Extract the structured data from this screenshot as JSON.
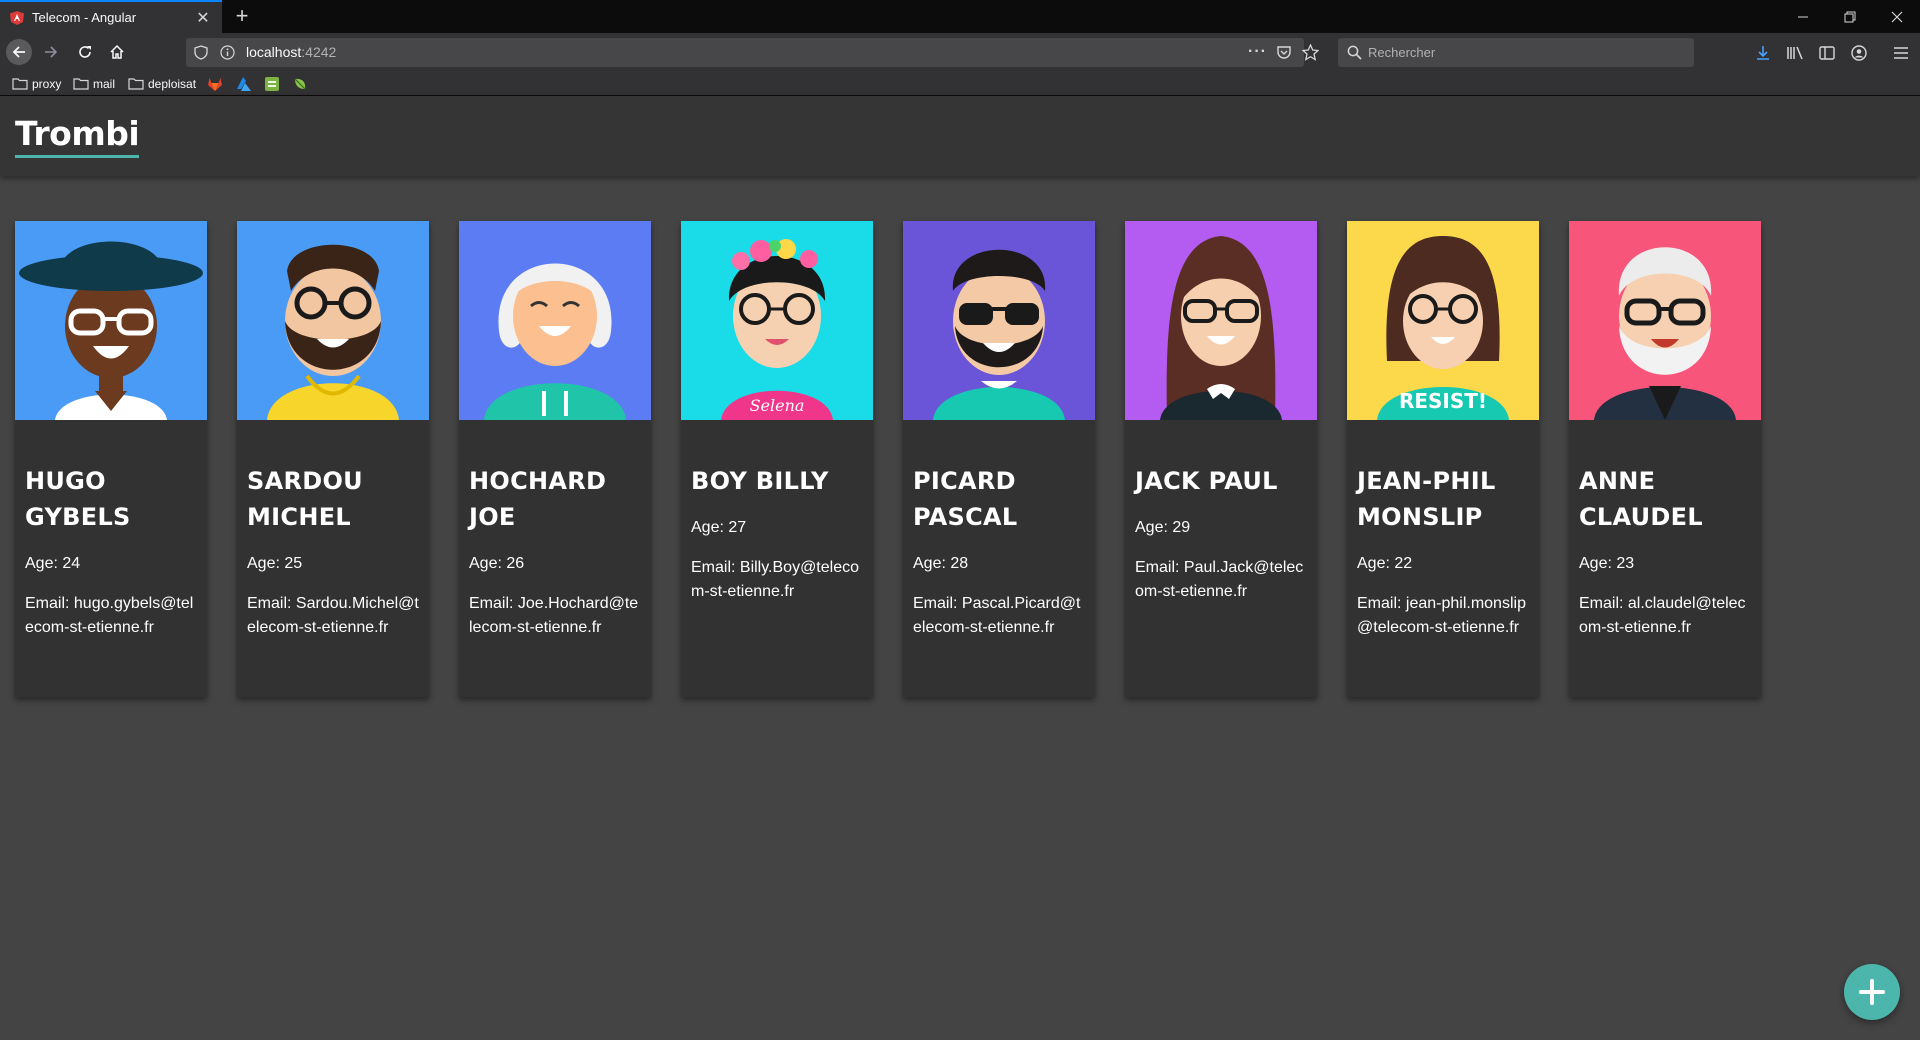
{
  "browser": {
    "tab_title": "Telecom - Angular",
    "new_tab": "+",
    "url_host": "localhost",
    "url_port": ":4242",
    "search_placeholder": "Rechercher",
    "bookmarks": [
      "proxy",
      "mail",
      "deploisat"
    ]
  },
  "app": {
    "title": "Trombi",
    "age_prefix": "Age: ",
    "email_prefix": "Email: ",
    "add_button": "+"
  },
  "people": [
    {
      "name": "HUGO GYBELS",
      "age": "Age: 24",
      "email": "Email: hugo.gybels@telecom-st-etienne.fr",
      "bg": "#4a9bf5"
    },
    {
      "name": "SARDOU MICHEL",
      "age": "Age: 25",
      "email": "Email: Sardou.Michel@telecom-st-etienne.fr",
      "bg": "#4a9bf5"
    },
    {
      "name": "HOCHARD JOE",
      "age": "Age: 26",
      "email": "Email: Joe.Hochard@telecom-st-etienne.fr",
      "bg": "#5b7cf2"
    },
    {
      "name": "BOY BILLY",
      "age": "Age: 27",
      "email": "Email: Billy.Boy@telecom-st-etienne.fr",
      "bg": "#19dce8"
    },
    {
      "name": "PICARD PASCAL",
      "age": "Age: 28",
      "email": "Email: Pascal.Picard@telecom-st-etienne.fr",
      "bg": "#6a55d8"
    },
    {
      "name": "JACK PAUL",
      "age": "Age: 29",
      "email": "Email: Paul.Jack@telecom-st-etienne.fr",
      "bg": "#b45cf2"
    },
    {
      "name": "JEAN-PHIL MONSLIP",
      "age": "Age: 22",
      "email": "Email: jean-phil.monslip@telecom-st-etienne.fr",
      "bg": "#fbd94a"
    },
    {
      "name": "ANNE CLAUDEL",
      "age": "Age: 23",
      "email": "Email: al.claudel@telecom-st-etienne.fr",
      "bg": "#f7557a"
    }
  ],
  "avatar_art": [
    {
      "shirt_text": ""
    },
    {
      "shirt_text": ""
    },
    {
      "shirt_text": ""
    },
    {
      "shirt_text": "Selena"
    },
    {
      "shirt_text": ""
    },
    {
      "shirt_text": ""
    },
    {
      "shirt_text": "RESIST!"
    },
    {
      "shirt_text": ""
    }
  ],
  "colors": {
    "accent": "#4db6ac",
    "page_bg": "#444445",
    "card_bg": "#323233"
  }
}
